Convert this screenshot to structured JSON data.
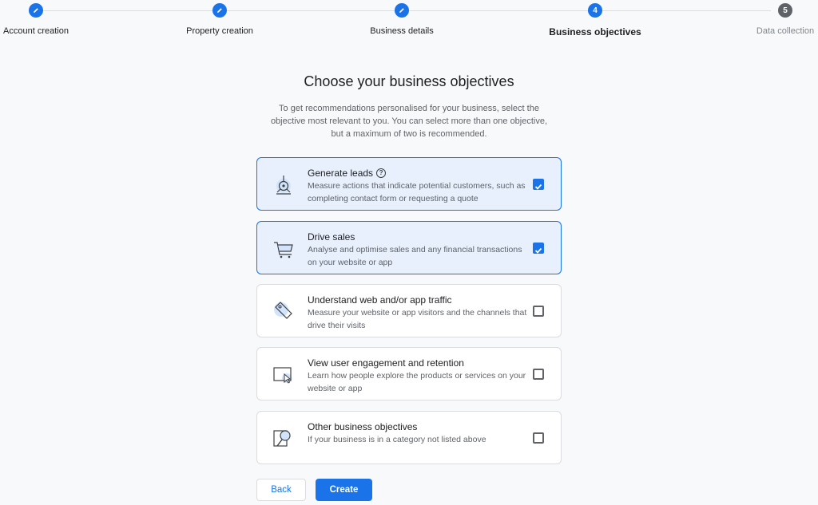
{
  "stepper": {
    "steps": [
      {
        "label": "Account creation",
        "state": "done",
        "number": ""
      },
      {
        "label": "Property creation",
        "state": "done",
        "number": ""
      },
      {
        "label": "Business details",
        "state": "done",
        "number": ""
      },
      {
        "label": "Business objectives",
        "state": "active",
        "number": "4"
      },
      {
        "label": "Data collection",
        "state": "todo",
        "number": "5"
      }
    ]
  },
  "page": {
    "title": "Choose your business objectives",
    "subtitle": "To get recommendations personalised for your business, select the objective most relevant to you. You can select more than one objective, but a maximum of two is recommended."
  },
  "objectives": [
    {
      "title": "Generate leads",
      "has_help": true,
      "description": "Measure actions that indicate potential customers, such as completing contact form or requesting a quote",
      "checked": true,
      "icon": "leads-icon"
    },
    {
      "title": "Drive sales",
      "has_help": false,
      "description": "Analyse and optimise sales and any financial transactions on your website or app",
      "checked": true,
      "icon": "shopping-cart-icon"
    },
    {
      "title": "Understand web and/or app traffic",
      "has_help": false,
      "description": "Measure your website or app visitors and the channels that drive their visits",
      "checked": false,
      "icon": "tag-icon"
    },
    {
      "title": "View user engagement and retention",
      "has_help": false,
      "description": "Learn how people explore the products or services on your website or app",
      "checked": false,
      "icon": "screen-cursor-icon"
    },
    {
      "title": "Other business objectives",
      "has_help": false,
      "description": "If your business is in a category not listed above",
      "checked": false,
      "icon": "magnifier-icon"
    }
  ],
  "help_glyph": "?",
  "buttons": {
    "back": "Back",
    "create": "Create"
  },
  "colors": {
    "accent": "#1a73e8",
    "selected_bg": "#e8f0fe",
    "todo": "#5f6368"
  }
}
